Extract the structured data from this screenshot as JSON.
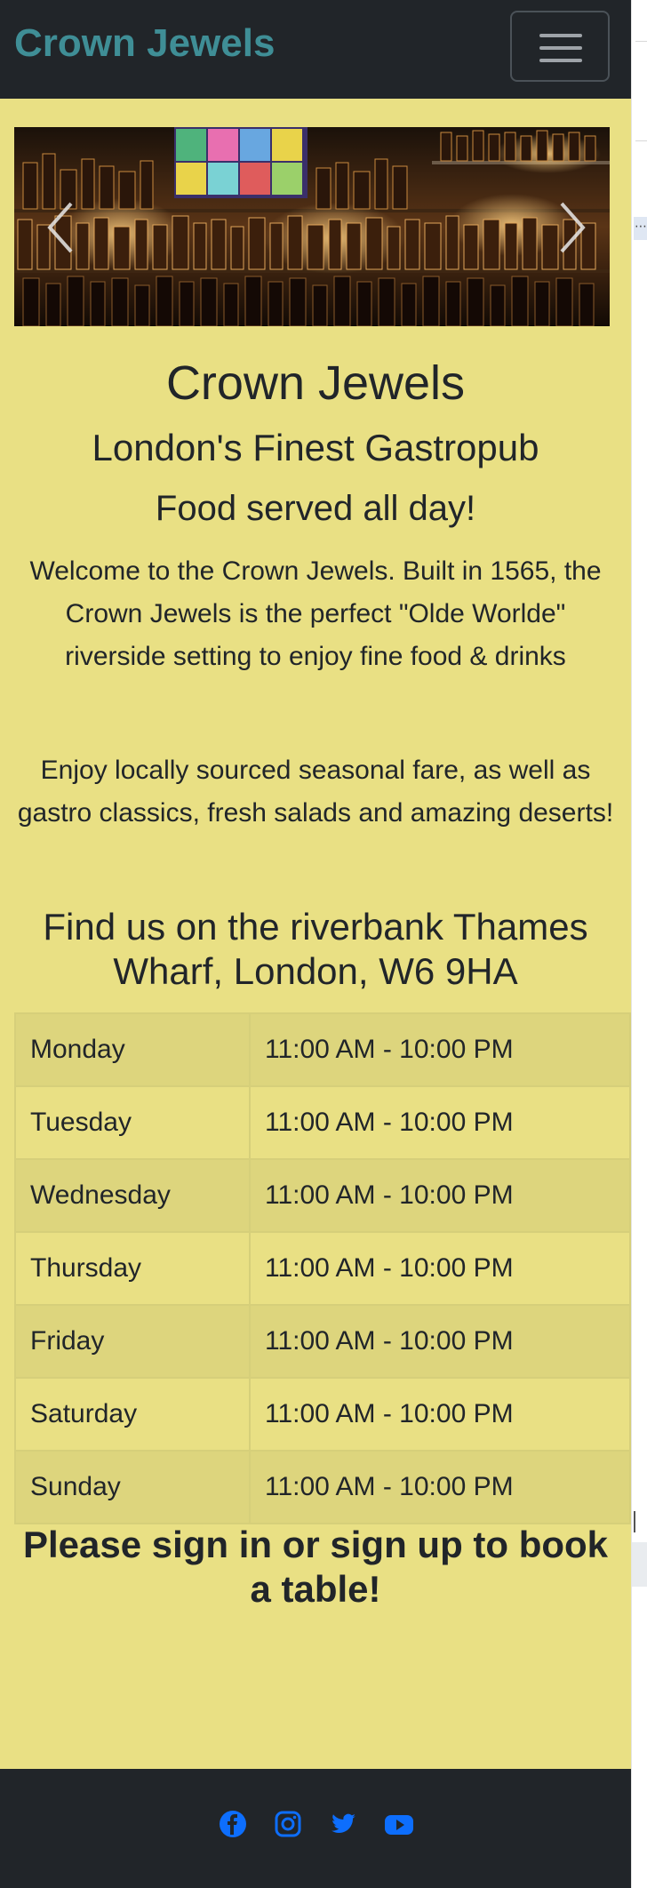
{
  "navbar": {
    "brand": "Crown Jewels"
  },
  "carousel": {
    "image_alt": "bar shelves with bottles",
    "prev_icon": "chevron-left-icon",
    "next_icon": "chevron-right-icon"
  },
  "hero": {
    "title": "Crown Jewels",
    "subtitle": "London's Finest Gastropub",
    "tagline": "Food served all day!"
  },
  "intro": {
    "paragraph1": "Welcome to the Crown Jewels. Built in 1565, the Crown Jewels is the perfect \"Olde Worlde\" riverside setting to enjoy fine food & drinks",
    "paragraph2": "Enjoy locally sourced seasonal fare, as well as gastro classics, fresh salads and amazing deserts!"
  },
  "location": {
    "heading": "Find us on the riverbank Thames Wharf, London, W6 9HA"
  },
  "hours": [
    {
      "day": "Monday",
      "time": "11:00 AM - 10:00 PM"
    },
    {
      "day": "Tuesday",
      "time": "11:00 AM - 10:00 PM"
    },
    {
      "day": "Wednesday",
      "time": "11:00 AM - 10:00 PM"
    },
    {
      "day": "Thursday",
      "time": "11:00 AM - 10:00 PM"
    },
    {
      "day": "Friday",
      "time": "11:00 AM - 10:00 PM"
    },
    {
      "day": "Saturday",
      "time": "11:00 AM - 10:00 PM"
    },
    {
      "day": "Sunday",
      "time": "11:00 AM - 10:00 PM"
    }
  ],
  "booking": {
    "message": "Please sign in or sign up to book a table!"
  },
  "footer": {
    "social": [
      "facebook-icon",
      "instagram-icon",
      "twitter-icon",
      "youtube-icon"
    ]
  },
  "colors": {
    "navbar_bg": "#212529",
    "brand": "#3f8e96",
    "page_bg": "#e9e084",
    "table_stripe": "#ddd57d",
    "social_icon": "#0d6efd"
  }
}
